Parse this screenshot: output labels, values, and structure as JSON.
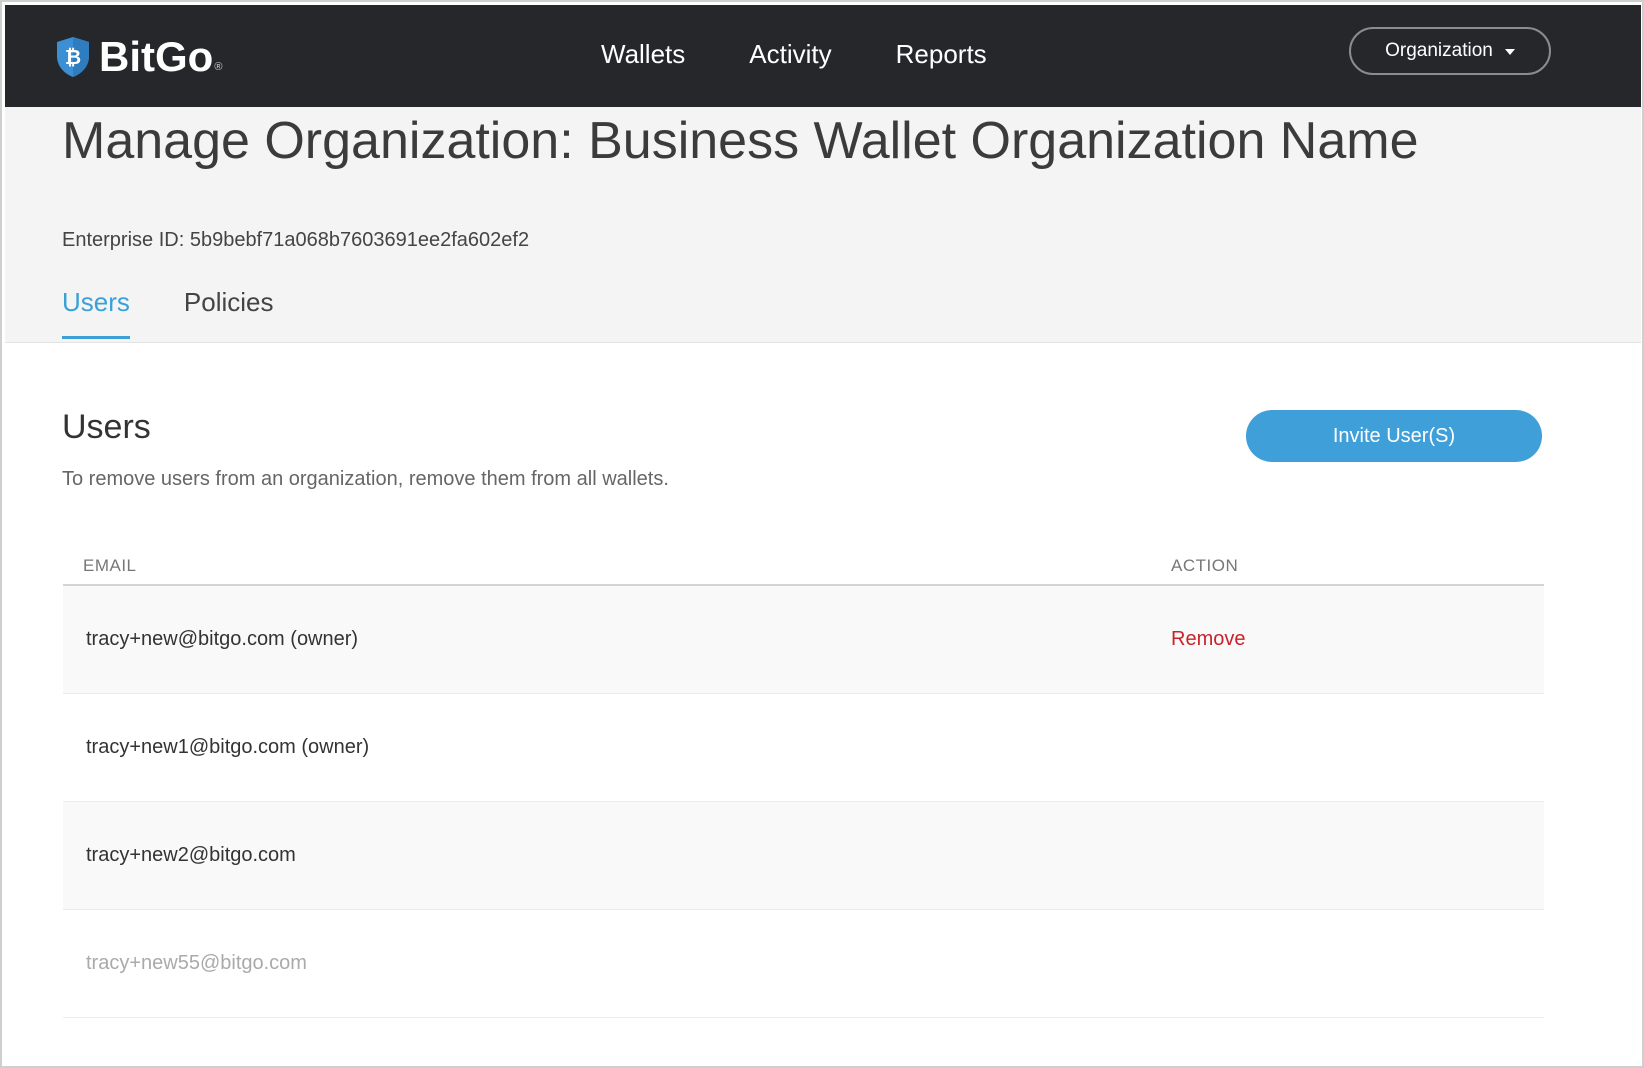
{
  "brand": {
    "name": "BitGo",
    "reg_mark": "®",
    "shield_glyph": "₿"
  },
  "nav": {
    "links": [
      "Wallets",
      "Activity",
      "Reports"
    ],
    "org_button": "Organization"
  },
  "header": {
    "title": "Manage Organization: Business Wallet Organization Name",
    "enterprise_id": "Enterprise ID: 5b9bebf71a068b7603691ee2fa602ef2",
    "tabs": [
      {
        "label": "Users",
        "active": true
      },
      {
        "label": "Policies",
        "active": false
      }
    ]
  },
  "users_section": {
    "title": "Users",
    "description": "To remove users from an organization, remove them from all wallets.",
    "invite_button": "Invite User(S)"
  },
  "table": {
    "columns": [
      "EMAIL",
      "ACTION"
    ],
    "rows": [
      {
        "email": "tracy+new@bitgo.com (owner)",
        "action": "Remove"
      },
      {
        "email": "tracy+new1@bitgo.com (owner)",
        "action": ""
      },
      {
        "email": "tracy+new2@bitgo.com",
        "action": ""
      },
      {
        "email": "tracy+new55@bitgo.com",
        "action": ""
      }
    ]
  },
  "colors": {
    "nav_bg": "#26272b",
    "accent": "#3aa0d6",
    "button": "#3f9fd8",
    "danger": "#c8232c",
    "header_bg": "#f4f4f4"
  }
}
